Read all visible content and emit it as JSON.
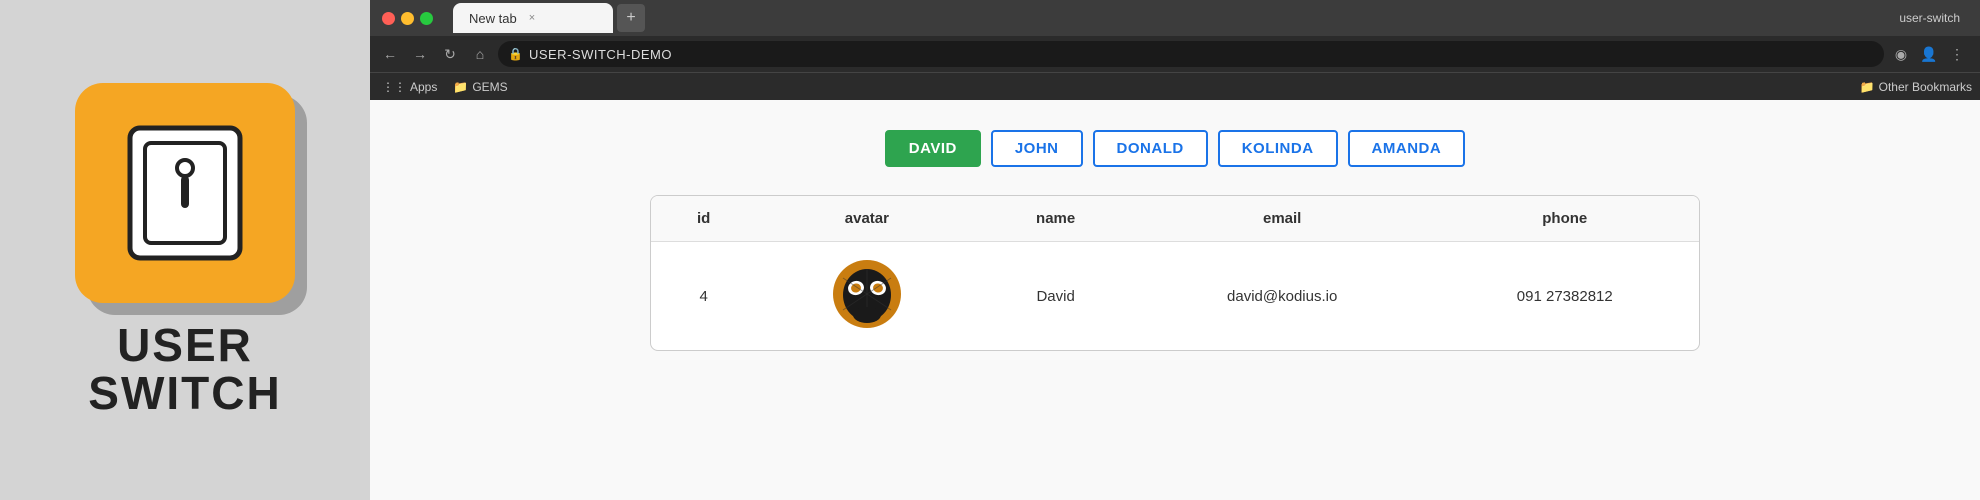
{
  "leftPanel": {
    "logoAlt": "User Switch Logo",
    "title_line1": "USER",
    "title_line2": "SWITCH"
  },
  "browser": {
    "windowTitle": "user-switch",
    "tab": {
      "label": "New tab",
      "closeIcon": "×"
    },
    "addressBar": {
      "url": "USER-SWITCH-DEMO",
      "lockIcon": "🔒"
    },
    "bookmarks": [
      {
        "label": "Apps",
        "icon": "⋮⋮"
      },
      {
        "label": "GEMS",
        "icon": "📁"
      }
    ],
    "otherBookmarks": "Other Bookmarks"
  },
  "content": {
    "userButtons": [
      {
        "label": "DAVID",
        "active": true
      },
      {
        "label": "JOHN",
        "active": false
      },
      {
        "label": "DONALD",
        "active": false
      },
      {
        "label": "KOLINDA",
        "active": false
      },
      {
        "label": "AMANDA",
        "active": false
      }
    ],
    "table": {
      "columns": [
        "id",
        "avatar",
        "name",
        "email",
        "phone"
      ],
      "rows": [
        {
          "id": "4",
          "avatarType": "spiderman",
          "name": "David",
          "email": "david@kodius.io",
          "phone": "091 27382812"
        }
      ]
    }
  }
}
